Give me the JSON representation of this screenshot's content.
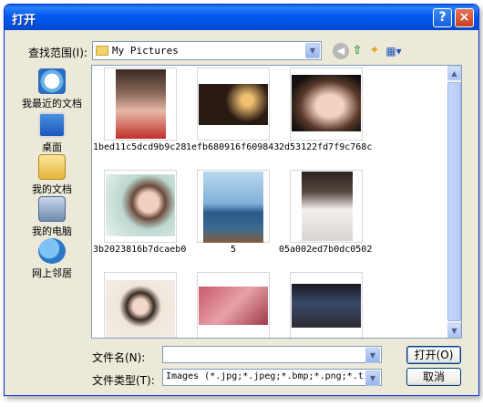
{
  "window": {
    "title": "打开",
    "help_label": "?",
    "close_label": "×"
  },
  "toolbar": {
    "lookin_label": "查找范围(I):",
    "lookin_value": "My Pictures",
    "back_icon": "back-arrow-icon",
    "up_icon": "up-folder-icon",
    "newfolder_icon": "new-folder-icon",
    "views_icon": "views-menu-icon"
  },
  "places": [
    {
      "label": "我最近的文档",
      "icon": "recent-documents-icon"
    },
    {
      "label": "桌面",
      "icon": "desktop-icon"
    },
    {
      "label": "我的文档",
      "icon": "my-documents-icon"
    },
    {
      "label": "我的电脑",
      "icon": "my-computer-icon"
    },
    {
      "label": "网上邻居",
      "icon": "network-places-icon"
    }
  ],
  "files": [
    {
      "name": "1bed11c5dcd9b9c28..."
    },
    {
      "name": "1efb680916f609843..."
    },
    {
      "name": "2d53122fd7f9c768c..."
    },
    {
      "name": "3b2023816b7dcaeb0..."
    },
    {
      "name": "5"
    },
    {
      "name": "05a002ed7b0dc0502..."
    },
    {
      "name": ""
    },
    {
      "name": ""
    },
    {
      "name": ""
    }
  ],
  "form": {
    "filename_label": "文件名(N):",
    "filename_value": "",
    "filetype_label": "文件类型(T):",
    "filetype_value": "Images (*.jpg;*.jpeg;*.bmp;*.png;*.tif;*.tiff;",
    "open_label": "打开(O)",
    "cancel_label": "取消"
  },
  "colors": {
    "titlebar": "#0058ee",
    "dialog": "#ece9d8",
    "border": "#7f9db9"
  }
}
